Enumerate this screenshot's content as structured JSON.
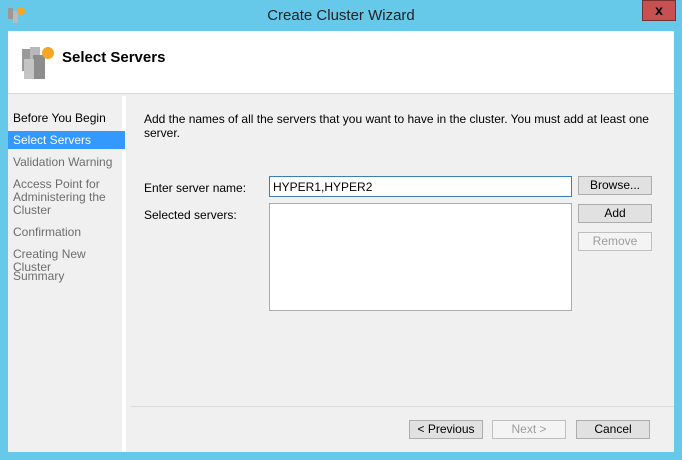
{
  "window": {
    "title": "Create Cluster Wizard",
    "close_label": "x"
  },
  "header": {
    "title": "Select Servers"
  },
  "nav": {
    "items": [
      {
        "label": "Before You Begin",
        "state": "done"
      },
      {
        "label": "Select Servers",
        "state": "active"
      },
      {
        "label": "Validation Warning",
        "state": "pending"
      },
      {
        "label": "Access Point for Administering the Cluster",
        "state": "pending"
      },
      {
        "label": "Confirmation",
        "state": "pending"
      },
      {
        "label": "Creating New Cluster",
        "state": "pending"
      },
      {
        "label": "Summary",
        "state": "pending"
      }
    ]
  },
  "main": {
    "intro": "Add the names of all the servers that you want to have in the cluster. You must add at least one server.",
    "server_name_label": "Enter server name:",
    "server_name_value": "HYPER1,HYPER2",
    "selected_label": "Selected servers:",
    "browse": "Browse...",
    "add": "Add",
    "remove": "Remove"
  },
  "footer": {
    "previous": "< Previous",
    "next": "Next >",
    "cancel": "Cancel"
  }
}
